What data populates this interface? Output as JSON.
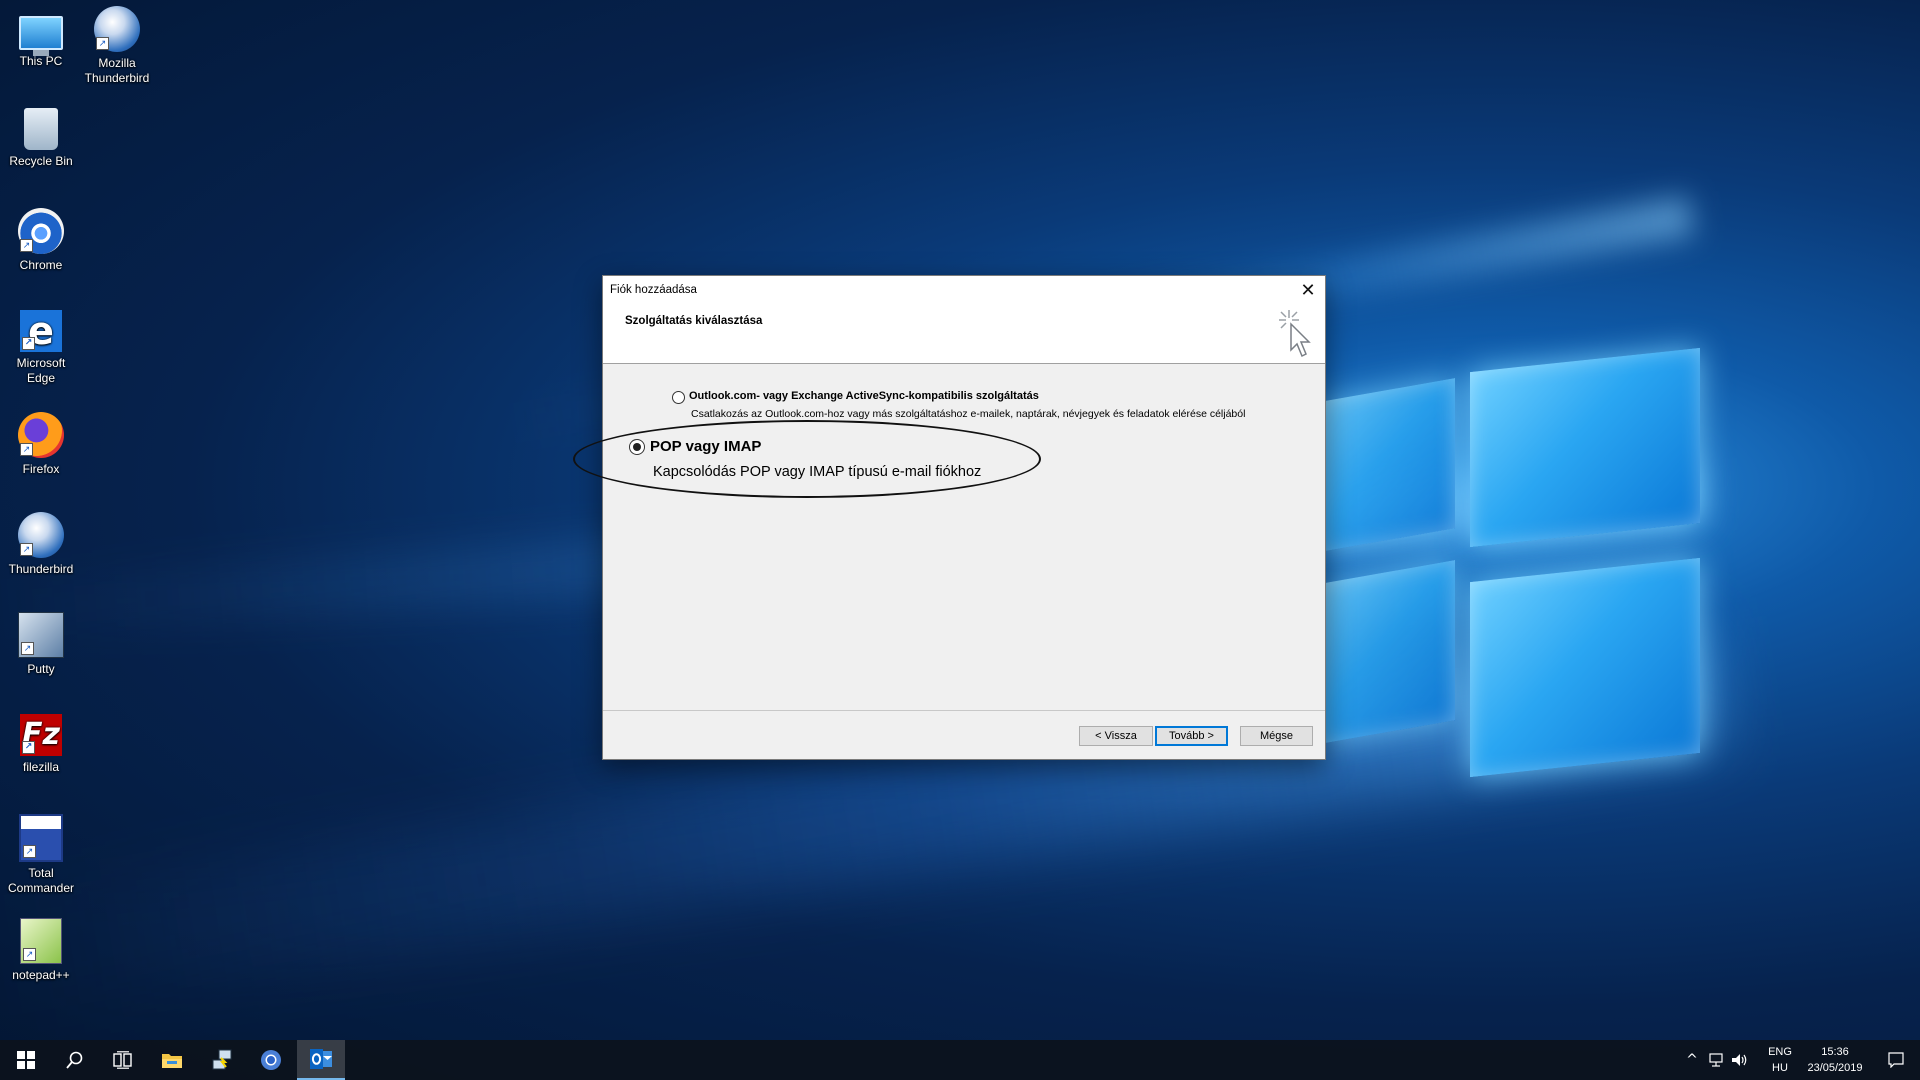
{
  "desktop": {
    "icons": [
      {
        "label": "This PC",
        "icon": "computer-icon"
      },
      {
        "label": "Mozilla Thunderbird",
        "icon": "thunderbird-icon"
      },
      {
        "label": "Recycle Bin",
        "icon": "recycle-bin-icon"
      },
      {
        "label": "Chrome",
        "icon": "chrome-icon"
      },
      {
        "label": "Microsoft Edge",
        "icon": "edge-icon"
      },
      {
        "label": "Firefox",
        "icon": "firefox-icon"
      },
      {
        "label": "Thunderbird",
        "icon": "thunderbird-icon"
      },
      {
        "label": "Putty",
        "icon": "putty-icon"
      },
      {
        "label": "filezilla",
        "icon": "filezilla-icon"
      },
      {
        "label": "Total Commander",
        "icon": "total-commander-icon"
      },
      {
        "label": "notepad++",
        "icon": "notepadpp-icon"
      }
    ]
  },
  "dialog": {
    "title": "Fiók hozzáadása",
    "heading": "Szolgáltatás kiválasztása",
    "option1": {
      "label": "Outlook.com- vagy Exchange ActiveSync-kompatibilis szolgáltatás",
      "description": "Csatlakozás az Outlook.com-hoz vagy más szolgáltatáshoz e-mailek, naptárak, névjegyek és feladatok elérése céljából",
      "selected": false
    },
    "option2": {
      "label": "POP vagy IMAP",
      "description": "Kapcsolódás POP vagy IMAP típusú e-mail fiókhoz",
      "selected": true
    },
    "buttons": {
      "back": "< Vissza",
      "next": "Tovább >",
      "cancel": "Mégse"
    },
    "close_glyph": "✕"
  },
  "taskbar": {
    "items": [
      "start-icon",
      "search-icon",
      "task-view-icon",
      "file-explorer-icon",
      "putty-icon",
      "chrome-icon",
      "outlook-icon"
    ],
    "active_item": "outlook-icon",
    "language": "ENG",
    "locale": "HU",
    "time": "15:36",
    "date": "23/05/2019"
  },
  "colors": {
    "accent": "#0078d7",
    "taskbar": "#0c121c"
  }
}
